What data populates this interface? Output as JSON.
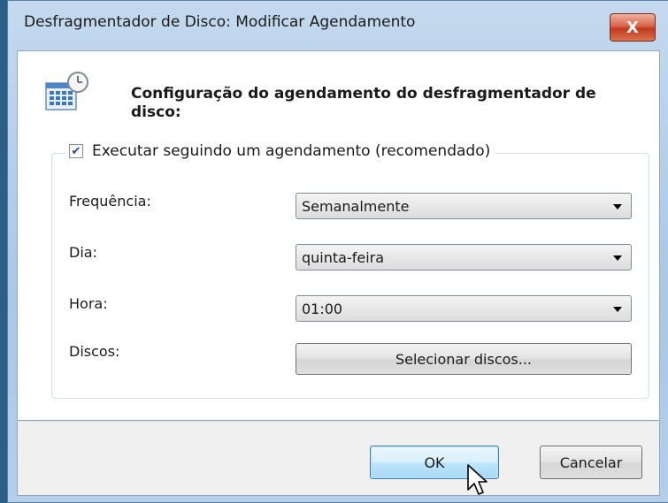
{
  "window": {
    "title": "Desfragmentador de Disco: Modificar Agendamento",
    "close_label": "X"
  },
  "header": {
    "text": "Configuração do agendamento do desfragmentador de disco:",
    "icon": "calendar-clock-icon"
  },
  "schedule": {
    "checkbox_label": "Executar seguindo um agendamento (recomendado)",
    "checked": true
  },
  "fields": {
    "frequency_label": "Frequência:",
    "frequency_value": "Semanalmente",
    "day_label": "Dia:",
    "day_value": "quinta-feira",
    "time_label": "Hora:",
    "time_value": "01:00",
    "disks_label": "Discos:",
    "disks_button": "Selecionar discos..."
  },
  "buttons": {
    "ok": "OK",
    "cancel": "Cancelar"
  }
}
